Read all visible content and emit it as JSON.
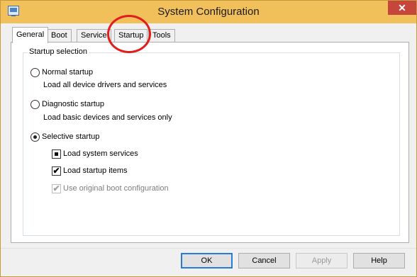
{
  "window": {
    "title": "System Configuration",
    "close_glyph": "✕",
    "icon": "msconfig-icon"
  },
  "tabs": [
    {
      "label": "General",
      "active": true
    },
    {
      "label": "Boot",
      "active": false
    },
    {
      "label": "Service",
      "active": false
    },
    {
      "label": "Startup",
      "active": false
    },
    {
      "label": "Tools",
      "active": false
    }
  ],
  "startup_selection": {
    "legend": "Startup selection",
    "normal": {
      "label": "Normal startup",
      "description": "Load all device drivers and services",
      "selected": false
    },
    "diagnostic": {
      "label": "Diagnostic startup",
      "description": "Load basic devices and services only",
      "selected": false
    },
    "selective": {
      "label": "Selective startup",
      "selected": true,
      "options": [
        {
          "label": "Load system services",
          "state": "indeterminate",
          "enabled": true
        },
        {
          "label": "Load startup items",
          "state": "checked",
          "check_glyph": "✔",
          "enabled": true
        },
        {
          "label": "Use original boot configuration",
          "state": "checked",
          "check_glyph": "✔",
          "enabled": false
        }
      ]
    }
  },
  "buttons": {
    "ok": "OK",
    "cancel": "Cancel",
    "apply": "Apply",
    "help": "Help"
  },
  "colors": {
    "titlebar": "#f2c05a",
    "annotation_circle": "#e21d1d",
    "default_button_border": "#2a7bd6"
  }
}
